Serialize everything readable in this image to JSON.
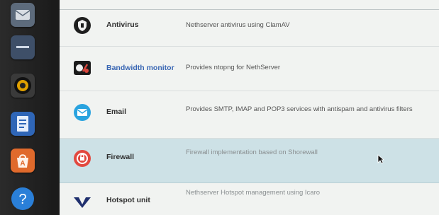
{
  "dock": {
    "items": [
      {
        "icon": "mail-icon"
      },
      {
        "icon": "minimize-icon"
      },
      {
        "icon": "speaker-icon"
      },
      {
        "icon": "document-icon"
      },
      {
        "icon": "app-store-icon"
      },
      {
        "icon": "help-icon"
      }
    ]
  },
  "modules": [
    {
      "name": "Antivirus",
      "description": "Nethserver antivirus using ClamAV",
      "icon": "shield-icon"
    },
    {
      "name": "Bandwidth monitor",
      "description": "Provides ntopng for NethServer",
      "icon": "monitor-icon"
    },
    {
      "name": "Email",
      "description": "Provides SMTP, IMAP and POP3 services with antispam and antivirus filters",
      "icon": "envelope-icon"
    },
    {
      "name": "Firewall",
      "description": "Firewall implementation based on Shorewall",
      "icon": "firewall-icon",
      "selected": true
    },
    {
      "name": "Hotspot unit",
      "description": "Nethserver Hotspot management using Icaro",
      "icon": "hotspot-icon"
    }
  ],
  "colors": {
    "link": "#3a67b4",
    "selected_row": "#cde1e6",
    "email_icon": "#29a3df",
    "firewall_icon": "#e2483f",
    "hotspot_icon": "#1f2f6e"
  }
}
